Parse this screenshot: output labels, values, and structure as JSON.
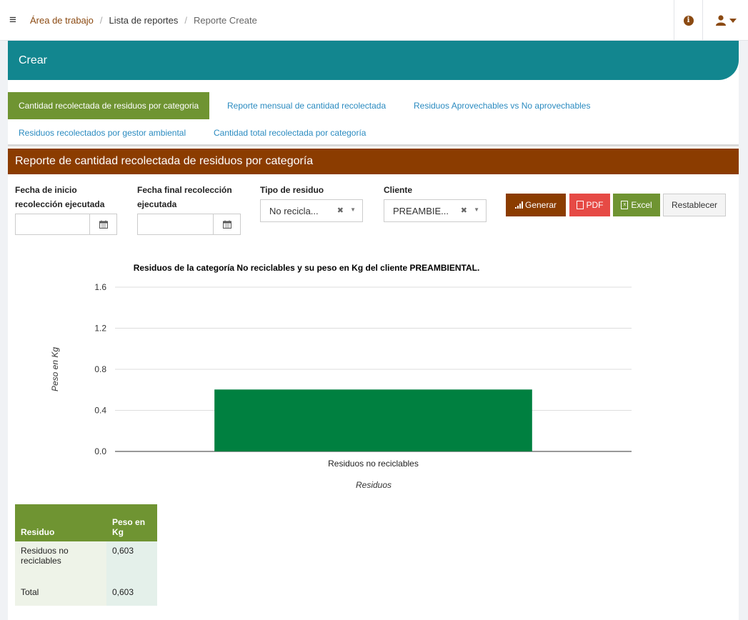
{
  "breadcrumbs": [
    "Área de trabajo",
    "Lista de reportes",
    "Reporte Create"
  ],
  "card": {
    "title": "Crear"
  },
  "tabs": [
    {
      "label": "Cantidad recolectada de residuos por categoria",
      "active": true
    },
    {
      "label": "Reporte mensual de cantidad recolectada",
      "active": false
    },
    {
      "label": "Residuos Aprovechables vs No aprovechables",
      "active": false
    },
    {
      "label": "Residuos recolectados por gestor ambiental",
      "active": false
    },
    {
      "label": "Cantidad total recolectada por categoría",
      "active": false
    }
  ],
  "section": {
    "title": "Reporte de cantidad recolectada de residuos por categoría"
  },
  "filters": {
    "fecha_inicio": {
      "label_line1": "Fecha de inicio",
      "label_line2": "recolección ejecutada",
      "value": ""
    },
    "fecha_final": {
      "label_line1": "Fecha final recolección",
      "label_line2": "ejecutada",
      "value": ""
    },
    "tipo_residuo": {
      "label": "Tipo de residuo",
      "value": "No recicla..."
    },
    "cliente": {
      "label": "Cliente",
      "value": "PREAMBIE..."
    }
  },
  "buttons": {
    "generar": "Generar",
    "pdf": "PDF",
    "excel": "Excel",
    "restablecer": "Restablecer"
  },
  "chart_data": {
    "type": "bar",
    "title": "Residuos de la categoría No reciclables y su peso en Kg del cliente PREAMBIENTAL.",
    "xlabel": "Residuos",
    "ylabel": "Peso en Kg",
    "categories": [
      "Residuos no reciclables"
    ],
    "values": [
      0.603
    ],
    "ylim": [
      0,
      1.6
    ],
    "yticks": [
      "0.0",
      "0.4",
      "0.8",
      "1.2",
      "1.6"
    ],
    "grid": true,
    "colors": [
      "#008040"
    ]
  },
  "table": {
    "headers": [
      "Residuo",
      "Peso en Kg"
    ],
    "rows": [
      [
        "Residuos no reciclables",
        "0,603"
      ],
      [
        "Total",
        "0,603"
      ]
    ]
  },
  "colors": {
    "primary_teal": "#12868f",
    "brown": "#8b3c00",
    "green": "#6f9432",
    "pdf_red": "#e64a45",
    "bar": "#008040"
  }
}
